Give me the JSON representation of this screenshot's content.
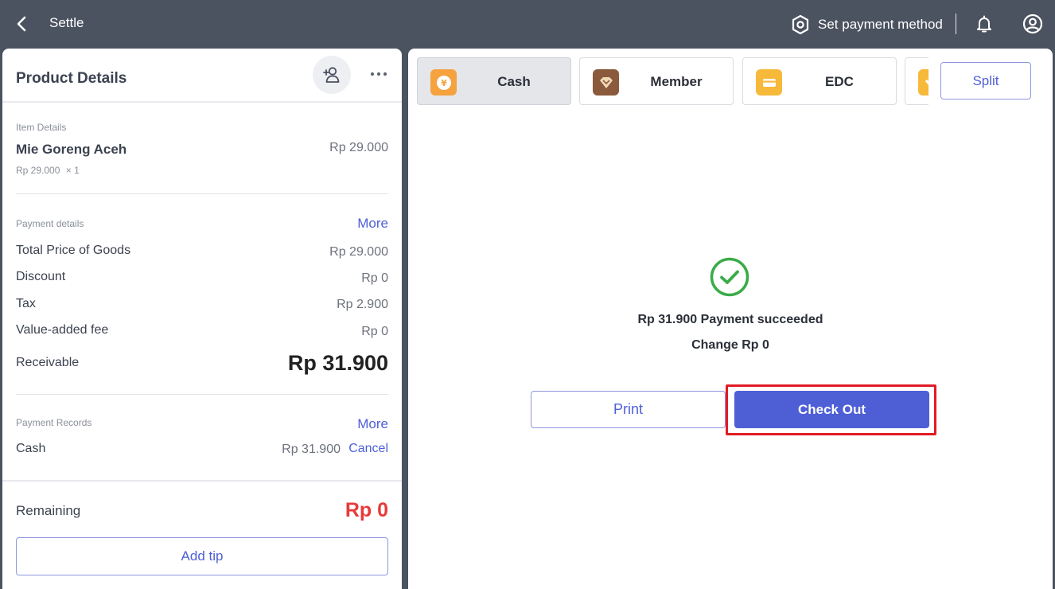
{
  "header": {
    "title": "Settle",
    "payment_method_label": "Set payment method",
    "icons": {
      "back": "chevron-left-icon",
      "payment_method": "hexagon-settings-icon",
      "notifications": "bell-icon",
      "account": "user-circle-icon"
    }
  },
  "product_details": {
    "title": "Product Details",
    "item_details": {
      "label": "Item Details",
      "name": "Mie Goreng Aceh",
      "price": "Rp 29.000",
      "unit_price": "Rp 29.000",
      "quantity_text": "× 1"
    },
    "payment_details": {
      "label": "Payment details",
      "more_label": "More",
      "rows": [
        {
          "label": "Total Price of Goods",
          "value": "Rp 29.000"
        },
        {
          "label": "Discount",
          "value": "Rp 0"
        },
        {
          "label": "Tax",
          "value": "Rp 2.900"
        },
        {
          "label": "Value-added fee",
          "value": "Rp 0"
        }
      ],
      "receivable_label": "Receivable",
      "receivable_value": "Rp 31.900"
    },
    "payment_records": {
      "label": "Payment Records",
      "more_label": "More",
      "records": [
        {
          "method": "Cash",
          "amount": "Rp 31.900",
          "action": "Cancel"
        }
      ]
    },
    "remaining_label": "Remaining",
    "remaining_value": "Rp 0",
    "add_tip_label": "Add tip"
  },
  "payment_methods": [
    {
      "label": "Cash",
      "icon": "yen-coin-icon",
      "color": "#f5a23f",
      "active": true
    },
    {
      "label": "Member",
      "icon": "diamond-icon",
      "color": "#8b5a3c",
      "active": false
    },
    {
      "label": "EDC",
      "icon": "card-icon",
      "color": "#f7b93a",
      "active": false
    },
    {
      "label": "",
      "icon": "wallet-icon",
      "color": "#f7b93a",
      "active": false
    }
  ],
  "split_label": "Split",
  "result": {
    "message": "Rp 31.900 Payment succeeded",
    "change": "Change Rp 0",
    "icon": "check-circle-icon",
    "color": "#3aab48"
  },
  "actions": {
    "print_label": "Print",
    "checkout_label": "Check Out"
  },
  "colors": {
    "accent": "#4e5fd6",
    "danger": "#e83a3a",
    "highlight": "#e01b24",
    "header_bg": "#4b5260"
  }
}
